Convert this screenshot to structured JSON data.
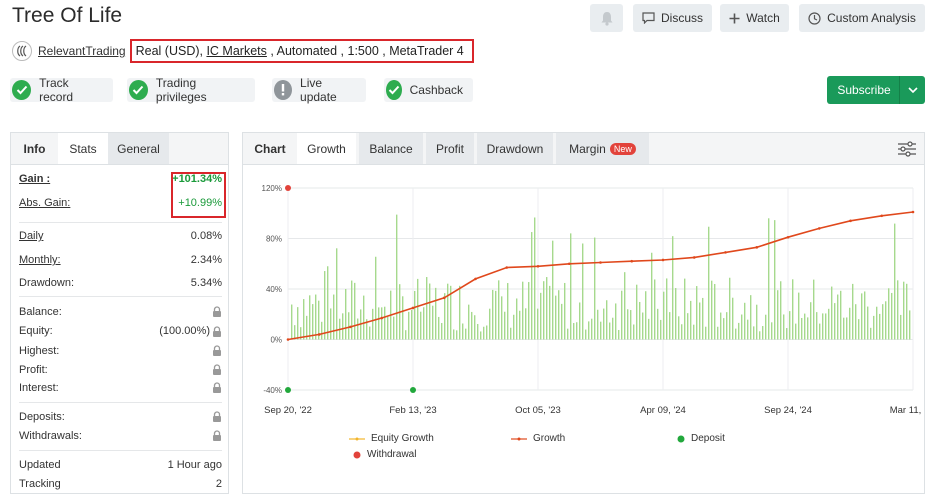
{
  "title": "Tree Of Life",
  "header_buttons": {
    "discuss": "Discuss",
    "watch": "Watch",
    "custom_analysis": "Custom Analysis"
  },
  "account": {
    "provider": "RelevantTrading",
    "type": "Real (USD), ",
    "broker": "IC Markets",
    "details": " , Automated , 1:500 , MetaTrader 4"
  },
  "badges": [
    "Track record",
    "Trading privileges",
    "Live update",
    "Cashback"
  ],
  "colors": {
    "green": "#1a9a5a",
    "check_green": "#2eac4f",
    "gray_badge": "#8f959a",
    "highlight_red": "#d9262b",
    "growth_line": "#e0481c",
    "volume_bar": "#a6d98d",
    "deposit": "#22a83c",
    "withdrawal": "#e2433b",
    "equity": "#f2b52b"
  },
  "subscribe_label": "Subscribe",
  "left_tabs": [
    "Info",
    "Stats",
    "General"
  ],
  "stats": {
    "gain_label": "Gain :",
    "gain_value": "+101.34%",
    "abs_gain_label": "Abs. Gain:",
    "abs_gain_value": "+10.99%",
    "daily_label": "Daily",
    "daily_value": "0.08%",
    "monthly_label": "Monthly:",
    "monthly_value": "2.34%",
    "drawdown_label": "Drawdown:",
    "drawdown_value": "5.34%",
    "balance_label": "Balance:",
    "equity_label": "Equity:",
    "equity_value": "(100.00%)",
    "highest_label": "Highest:",
    "profit_label": "Profit:",
    "interest_label": "Interest:",
    "deposits_label": "Deposits:",
    "withdrawals_label": "Withdrawals:",
    "updated_label": "Updated",
    "updated_value": "1 Hour ago",
    "tracking_label": "Tracking",
    "tracking_value": "2"
  },
  "chart_tabs": {
    "label": "Chart",
    "items": [
      "Growth",
      "Balance",
      "Profit",
      "Drawdown",
      "Margin"
    ],
    "new_badge": "New"
  },
  "chart_data": {
    "type": "line",
    "y_ticks": [
      "120%",
      "80%",
      "40%",
      "0%",
      "-40%"
    ],
    "x_ticks": [
      "Sep 20, '22",
      "Feb 13, '23",
      "Oct 05, '23",
      "Apr 09, '24",
      "Sep 24, '24",
      "Mar 11, '25"
    ],
    "ylim": [
      -40,
      120
    ],
    "grid": true,
    "legend_position": "bottom",
    "series": [
      {
        "name": "Growth",
        "x_frac": [
          0,
          0.05,
          0.1,
          0.15,
          0.2,
          0.25,
          0.3,
          0.35,
          0.4,
          0.45,
          0.5,
          0.55,
          0.6,
          0.65,
          0.7,
          0.75,
          0.8,
          0.85,
          0.9,
          0.95,
          1
        ],
        "values": [
          0,
          4,
          10,
          17,
          25,
          33,
          48,
          57,
          58,
          60,
          61,
          62,
          63,
          65,
          69,
          73,
          81,
          88,
          94,
          98,
          101
        ]
      },
      {
        "name": "Equity Growth",
        "values": []
      }
    ],
    "deposits": [
      "Sep 20, '22",
      "Feb 13, '23"
    ],
    "withdrawals": [
      "Sep 20, '22"
    ],
    "legend": [
      "Equity Growth",
      "Growth",
      "Deposit",
      "Withdrawal"
    ]
  }
}
